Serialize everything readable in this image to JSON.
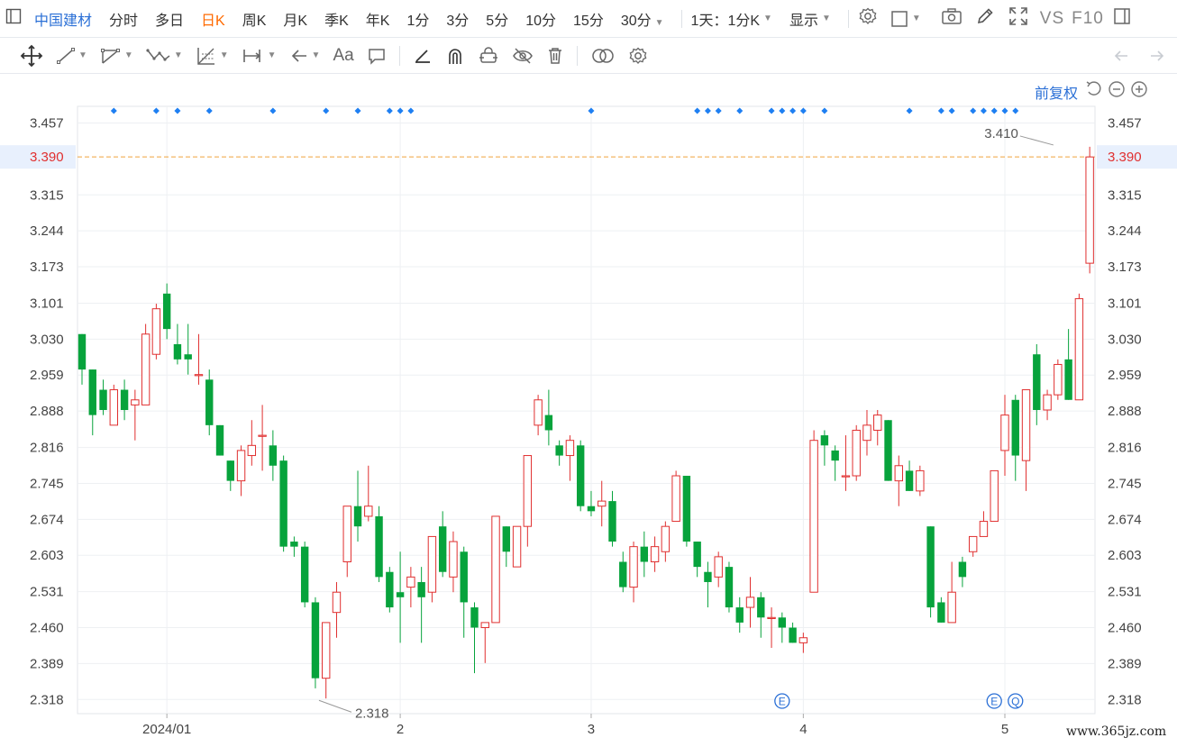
{
  "topbar": {
    "stock_name": "中国建材",
    "tabs": [
      {
        "label": "分时",
        "active": false
      },
      {
        "label": "多日",
        "active": false
      },
      {
        "label": "日K",
        "active": true
      },
      {
        "label": "周K",
        "active": false
      },
      {
        "label": "月K",
        "active": false
      },
      {
        "label": "季K",
        "active": false
      },
      {
        "label": "年K",
        "active": false
      },
      {
        "label": "1分",
        "active": false
      },
      {
        "label": "3分",
        "active": false
      },
      {
        "label": "5分",
        "active": false
      },
      {
        "label": "10分",
        "active": false
      },
      {
        "label": "15分",
        "active": false
      },
      {
        "label": "30分",
        "active": false
      }
    ],
    "period_select": "1天：1分K",
    "display_label": "显示",
    "vs_label": "VS",
    "f10_label": "F10"
  },
  "toolbar": {
    "text_tool_label": "Aa"
  },
  "adjust_label": "前复权",
  "watermark": "www.365jz.com",
  "colors": {
    "up": "#e02f2f",
    "down": "#07a33c",
    "accent": "#2a6fd6",
    "price_line": "#f0a33c",
    "marker": "#1e7ff2"
  },
  "chart_data": {
    "type": "candlestick",
    "ylim": [
      2.29,
      3.49
    ],
    "y_ticks": [
      "3.457",
      "3.315",
      "3.244",
      "3.173",
      "3.101",
      "3.030",
      "2.959",
      "2.888",
      "2.816",
      "2.745",
      "2.674",
      "2.603",
      "2.531",
      "2.460",
      "2.389",
      "2.318"
    ],
    "x_labels": [
      {
        "label": "2024/01",
        "index": 8
      },
      {
        "label": "2",
        "index": 30
      },
      {
        "label": "3",
        "index": 48
      },
      {
        "label": "4",
        "index": 68
      },
      {
        "label": "5",
        "index": 87
      }
    ],
    "current_price": "3.390",
    "current_price_value": 3.39,
    "high_annotation": {
      "label": "3.410",
      "value": 3.41,
      "index": 92
    },
    "low_annotation": {
      "label": "2.318",
      "value": 2.318,
      "index": 22
    },
    "event_markers": [
      {
        "label": "E",
        "index": 66
      },
      {
        "label": "E",
        "index": 86
      },
      {
        "label": "Q",
        "index": 88
      }
    ],
    "dividend_marker_indices": [
      3,
      7,
      9,
      12,
      18,
      23,
      26,
      29,
      30,
      31,
      48,
      58,
      59,
      60,
      62,
      65,
      66,
      67,
      68,
      70,
      78,
      81,
      82,
      84,
      85,
      86,
      87,
      88
    ],
    "candles": [
      [
        3.04,
        2.97,
        3.04,
        2.94
      ],
      [
        2.97,
        2.88,
        2.97,
        2.84
      ],
      [
        2.93,
        2.89,
        2.95,
        2.88
      ],
      [
        2.86,
        2.93,
        2.94,
        2.86
      ],
      [
        2.93,
        2.89,
        2.95,
        2.87
      ],
      [
        2.9,
        2.91,
        2.93,
        2.83
      ],
      [
        2.9,
        3.04,
        3.06,
        2.9
      ],
      [
        3.0,
        3.09,
        3.1,
        2.99
      ],
      [
        3.12,
        3.05,
        3.14,
        3.03
      ],
      [
        3.02,
        2.99,
        3.06,
        2.98
      ],
      [
        3.0,
        2.99,
        3.06,
        2.96
      ],
      [
        2.96,
        2.96,
        3.04,
        2.94
      ],
      [
        2.95,
        2.86,
        2.97,
        2.84
      ],
      [
        2.86,
        2.8,
        2.86,
        2.8
      ],
      [
        2.79,
        2.75,
        2.79,
        2.73
      ],
      [
        2.75,
        2.81,
        2.82,
        2.72
      ],
      [
        2.8,
        2.82,
        2.87,
        2.78
      ],
      [
        2.84,
        2.84,
        2.9,
        2.77
      ],
      [
        2.82,
        2.78,
        2.85,
        2.75
      ],
      [
        2.79,
        2.62,
        2.8,
        2.61
      ],
      [
        2.63,
        2.62,
        2.64,
        2.6
      ],
      [
        2.62,
        2.51,
        2.63,
        2.5
      ],
      [
        2.51,
        2.36,
        2.52,
        2.34
      ],
      [
        2.36,
        2.47,
        2.47,
        2.32
      ],
      [
        2.49,
        2.53,
        2.55,
        2.44
      ],
      [
        2.59,
        2.7,
        2.7,
        2.56
      ],
      [
        2.7,
        2.66,
        2.77,
        2.63
      ],
      [
        2.68,
        2.7,
        2.78,
        2.67
      ],
      [
        2.68,
        2.56,
        2.7,
        2.55
      ],
      [
        2.57,
        2.5,
        2.58,
        2.49
      ],
      [
        2.53,
        2.52,
        2.61,
        2.43
      ],
      [
        2.54,
        2.56,
        2.58,
        2.5
      ],
      [
        2.55,
        2.52,
        2.58,
        2.43
      ],
      [
        2.53,
        2.64,
        2.64,
        2.51
      ],
      [
        2.66,
        2.57,
        2.69,
        2.56
      ],
      [
        2.56,
        2.63,
        2.65,
        2.53
      ],
      [
        2.61,
        2.51,
        2.62,
        2.44
      ],
      [
        2.5,
        2.46,
        2.51,
        2.37
      ],
      [
        2.46,
        2.47,
        2.47,
        2.39
      ],
      [
        2.47,
        2.68,
        2.68,
        2.47
      ],
      [
        2.66,
        2.61,
        2.66,
        2.58
      ],
      [
        2.58,
        2.66,
        2.66,
        2.58
      ],
      [
        2.66,
        2.8,
        2.8,
        2.62
      ],
      [
        2.86,
        2.91,
        2.92,
        2.84
      ],
      [
        2.88,
        2.85,
        2.93,
        2.82
      ],
      [
        2.82,
        2.8,
        2.83,
        2.78
      ],
      [
        2.8,
        2.83,
        2.84,
        2.75
      ],
      [
        2.82,
        2.7,
        2.83,
        2.69
      ],
      [
        2.7,
        2.69,
        2.73,
        2.68
      ],
      [
        2.7,
        2.71,
        2.75,
        2.66
      ],
      [
        2.71,
        2.63,
        2.73,
        2.62
      ],
      [
        2.59,
        2.54,
        2.61,
        2.53
      ],
      [
        2.54,
        2.62,
        2.63,
        2.51
      ],
      [
        2.62,
        2.59,
        2.65,
        2.56
      ],
      [
        2.59,
        2.62,
        2.64,
        2.57
      ],
      [
        2.61,
        2.66,
        2.67,
        2.59
      ],
      [
        2.67,
        2.76,
        2.77,
        2.67
      ],
      [
        2.76,
        2.63,
        2.76,
        2.62
      ],
      [
        2.63,
        2.58,
        2.63,
        2.56
      ],
      [
        2.57,
        2.55,
        2.59,
        2.5
      ],
      [
        2.56,
        2.6,
        2.61,
        2.54
      ],
      [
        2.58,
        2.5,
        2.59,
        2.49
      ],
      [
        2.5,
        2.47,
        2.52,
        2.45
      ],
      [
        2.5,
        2.52,
        2.56,
        2.46
      ],
      [
        2.52,
        2.48,
        2.53,
        2.44
      ],
      [
        2.48,
        2.48,
        2.5,
        2.42
      ],
      [
        2.48,
        2.46,
        2.49,
        2.43
      ],
      [
        2.46,
        2.43,
        2.47,
        2.43
      ],
      [
        2.43,
        2.44,
        2.45,
        2.41
      ],
      [
        2.53,
        2.83,
        2.85,
        2.53
      ],
      [
        2.84,
        2.82,
        2.85,
        2.78
      ],
      [
        2.81,
        2.79,
        2.82,
        2.75
      ],
      [
        2.76,
        2.76,
        2.84,
        2.73
      ],
      [
        2.76,
        2.85,
        2.86,
        2.75
      ],
      [
        2.83,
        2.86,
        2.89,
        2.8
      ],
      [
        2.85,
        2.88,
        2.89,
        2.82
      ],
      [
        2.87,
        2.75,
        2.87,
        2.75
      ],
      [
        2.75,
        2.78,
        2.8,
        2.7
      ],
      [
        2.77,
        2.73,
        2.79,
        2.73
      ],
      [
        2.73,
        2.77,
        2.78,
        2.72
      ],
      [
        2.66,
        2.5,
        2.66,
        2.48
      ],
      [
        2.51,
        2.47,
        2.52,
        2.47
      ],
      [
        2.47,
        2.53,
        2.59,
        2.47
      ],
      [
        2.59,
        2.56,
        2.6,
        2.54
      ],
      [
        2.61,
        2.64,
        2.64,
        2.6
      ],
      [
        2.64,
        2.67,
        2.69,
        2.64
      ],
      [
        2.67,
        2.77,
        2.77,
        2.67
      ],
      [
        2.81,
        2.88,
        2.92,
        2.76
      ],
      [
        2.91,
        2.8,
        2.92,
        2.75
      ],
      [
        2.79,
        2.93,
        2.93,
        2.73
      ],
      [
        3.0,
        2.89,
        3.02,
        2.86
      ],
      [
        2.89,
        2.92,
        2.93,
        2.87
      ],
      [
        2.92,
        2.98,
        2.99,
        2.91
      ],
      [
        2.99,
        2.91,
        3.05,
        2.91
      ],
      [
        2.91,
        3.11,
        3.12,
        2.91
      ],
      [
        3.18,
        3.39,
        3.41,
        3.16
      ]
    ]
  }
}
